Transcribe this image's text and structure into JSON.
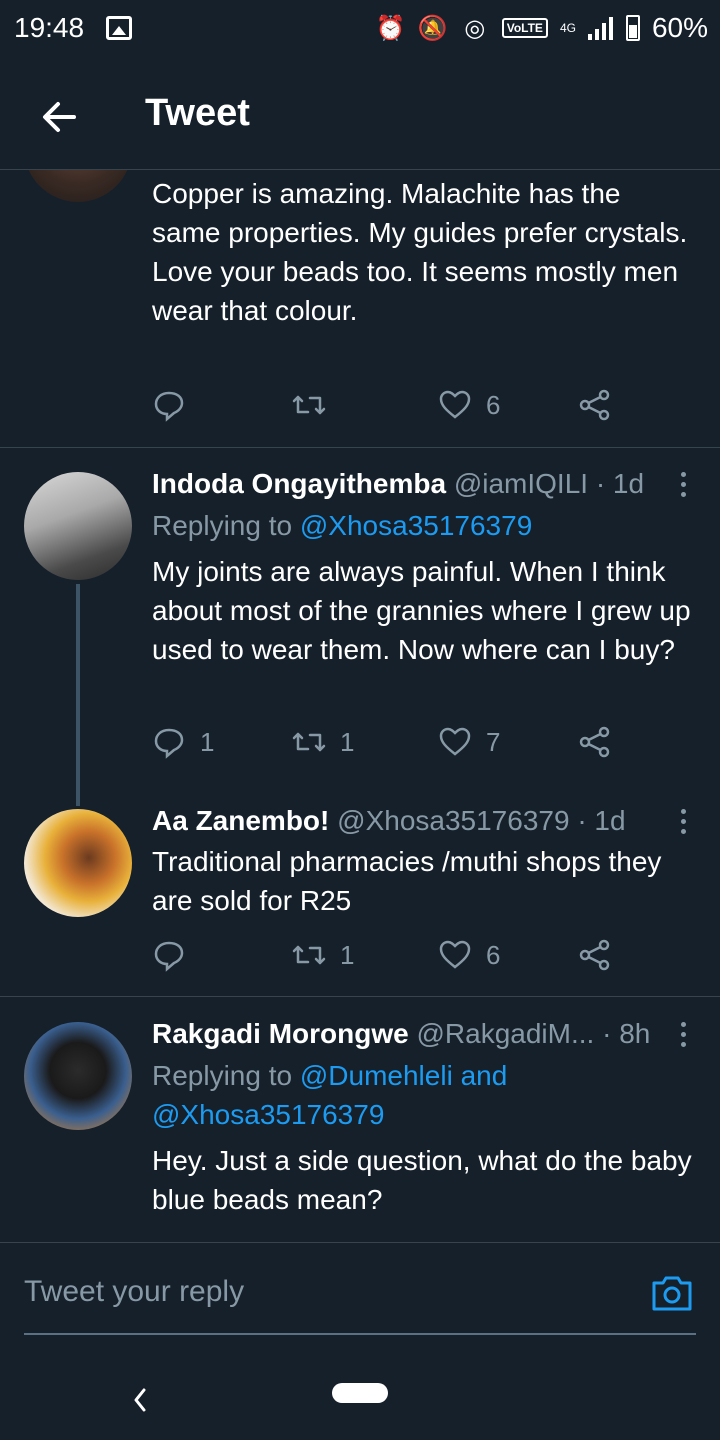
{
  "status_bar": {
    "time": "19:48",
    "network": "4G",
    "volte": "VoLTE",
    "battery": "60%"
  },
  "header": {
    "title": "Tweet"
  },
  "tweets": [
    {
      "text": "Copper is amazing. Malachite has the same properties. My guides prefer crystals.\nLove your beads too. It seems mostly men wear that colour.",
      "replies": "",
      "retweets": "",
      "likes": "6"
    },
    {
      "name": "Indoda Ongayithemba",
      "handle": "@iamIQILI",
      "time": "· 1d",
      "replying_prefix": "Replying to ",
      "replying_to": "@Xhosa35176379",
      "text": "My joints are always painful. When I think about most of the grannies where I grew up used to wear them. Now where can I buy?",
      "replies": "1",
      "retweets": "1",
      "likes": "7"
    },
    {
      "name": "Aa Zanembo!",
      "handle": "@Xhosa35176379",
      "time": "· 1d",
      "text": "Traditional pharmacies /muthi shops they are sold for R25",
      "replies": "",
      "retweets": "1",
      "likes": "6"
    },
    {
      "name": "Rakgadi Morongwe",
      "handle": "@RakgadiM...",
      "time": "· 8h",
      "replying_prefix": "Replying to ",
      "replying_to": "@Dumehleli and",
      "replying_to_2": "@Xhosa35176379",
      "text": "Hey. Just a side question, what do the baby blue beads mean?"
    }
  ],
  "reply_bar": {
    "placeholder": "Tweet your reply"
  },
  "colors": {
    "background": "#15202b",
    "link": "#1d9bf0",
    "muted": "#8899a6",
    "divider": "#38444d"
  }
}
